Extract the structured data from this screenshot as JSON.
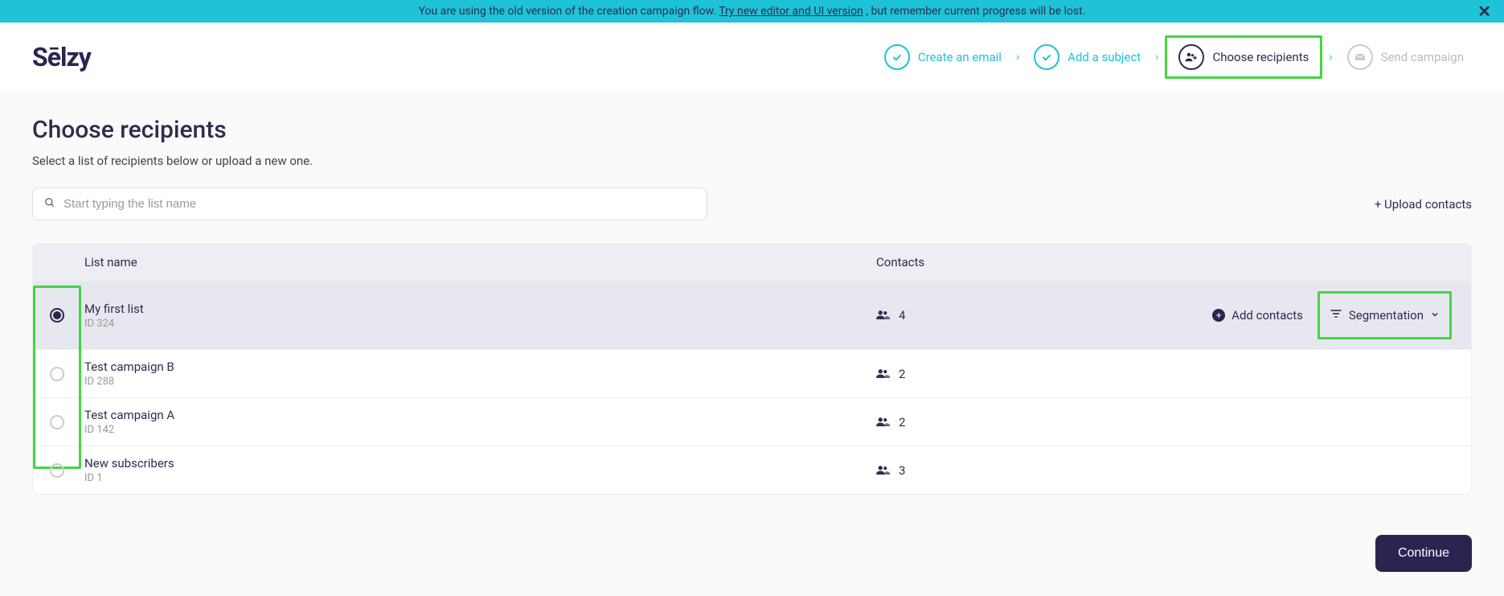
{
  "banner": {
    "text_before": "You are using the old version of the creation campaign flow. ",
    "link_text": "Try new editor and UI version",
    "text_after": ", but remember current progress will be lost."
  },
  "logo": "Sēlzy",
  "steps": [
    {
      "label": "Create an email",
      "state": "done"
    },
    {
      "label": "Add a subject",
      "state": "done"
    },
    {
      "label": "Choose recipients",
      "state": "current"
    },
    {
      "label": "Send campaign",
      "state": "disabled"
    }
  ],
  "page": {
    "title": "Choose recipients",
    "subtitle": "Select a list of recipients below or upload a new one."
  },
  "search": {
    "placeholder": "Start typing the list name"
  },
  "upload_link": "+ Upload contacts",
  "table": {
    "headers": {
      "name": "List name",
      "contacts": "Contacts"
    },
    "rows": [
      {
        "name": "My first list",
        "id": "ID 324",
        "contacts": "4",
        "selected": true
      },
      {
        "name": "Test campaign B",
        "id": "ID 288",
        "contacts": "2",
        "selected": false
      },
      {
        "name": "Test campaign A",
        "id": "ID 142",
        "contacts": "2",
        "selected": false
      },
      {
        "name": "New subscribers",
        "id": "ID 1",
        "contacts": "3",
        "selected": false
      }
    ]
  },
  "actions": {
    "add_contacts": "Add contacts",
    "segmentation": "Segmentation"
  },
  "continue_button": "Continue"
}
